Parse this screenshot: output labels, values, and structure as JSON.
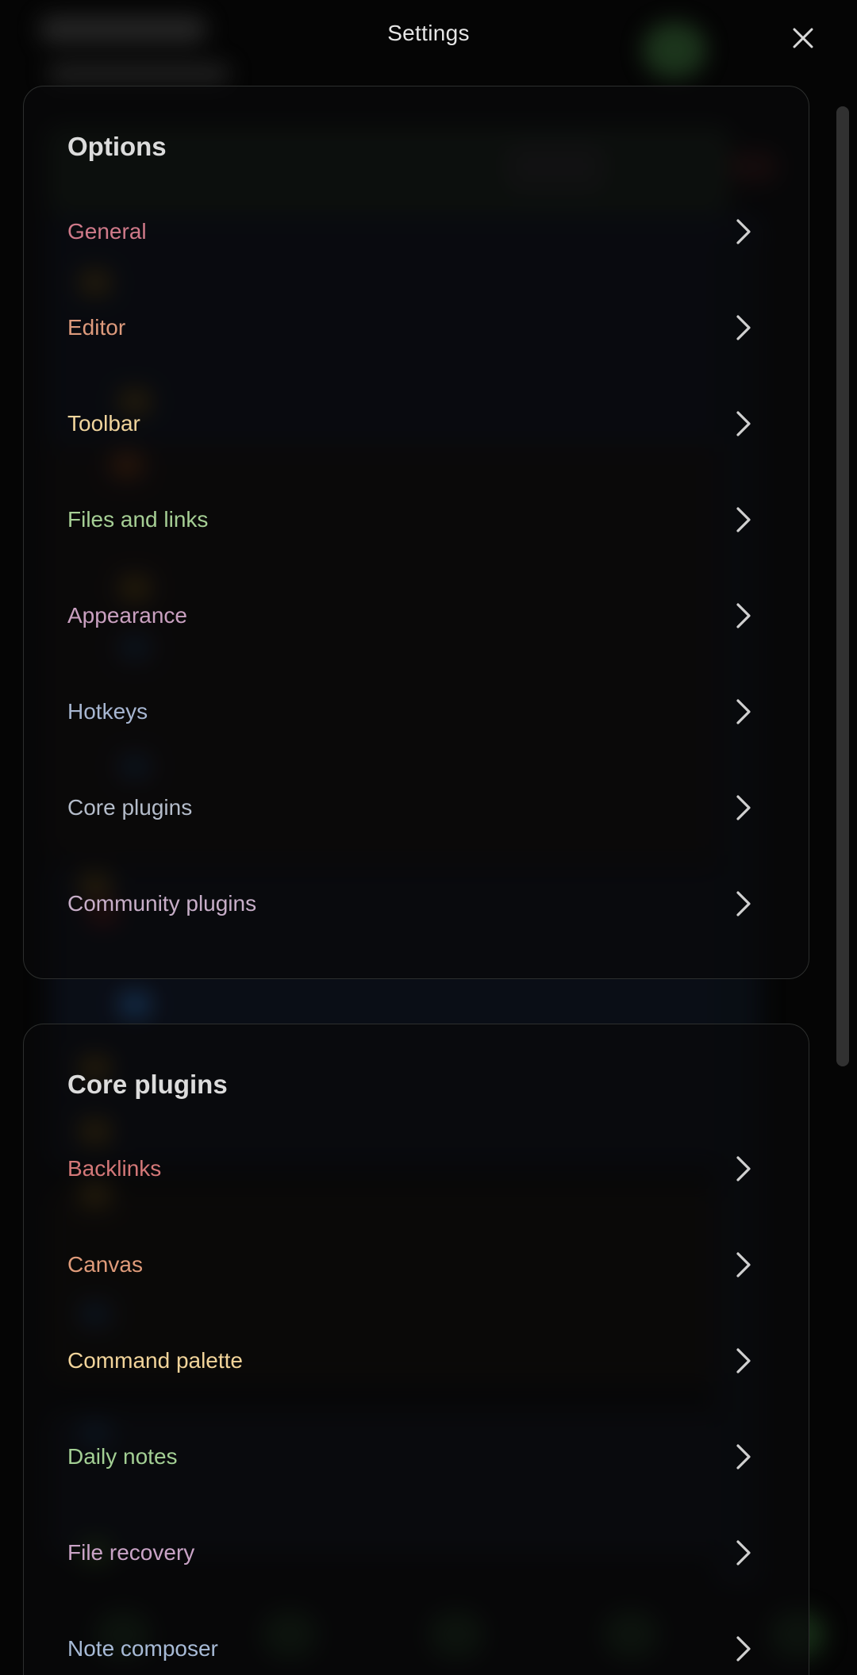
{
  "header": {
    "title": "Settings"
  },
  "sections": {
    "options": {
      "title": "Options",
      "items": [
        {
          "label": "General",
          "color": "#d07a8a"
        },
        {
          "label": "Editor",
          "color": "#dd9a7c"
        },
        {
          "label": "Toolbar",
          "color": "#f0d49c"
        },
        {
          "label": "Files and links",
          "color": "#a6cf95"
        },
        {
          "label": "Appearance",
          "color": "#c9a0c0"
        },
        {
          "label": "Hotkeys",
          "color": "#a7b6d1"
        },
        {
          "label": "Core plugins",
          "color": "#b4bcca"
        },
        {
          "label": "Community plugins",
          "color": "#c7aec8"
        }
      ]
    },
    "core_plugins": {
      "title": "Core plugins",
      "items": [
        {
          "label": "Backlinks",
          "color": "#d47878"
        },
        {
          "label": "Canvas",
          "color": "#df9b7a"
        },
        {
          "label": "Command palette",
          "color": "#f2d49a"
        },
        {
          "label": "Daily notes",
          "color": "#a3cf94"
        },
        {
          "label": "File recovery",
          "color": "#c9a3c6"
        },
        {
          "label": "Note composer",
          "color": "#a7bad6"
        }
      ]
    }
  },
  "icons": {
    "close": "close-icon",
    "chevron": "chevron-right-icon"
  }
}
